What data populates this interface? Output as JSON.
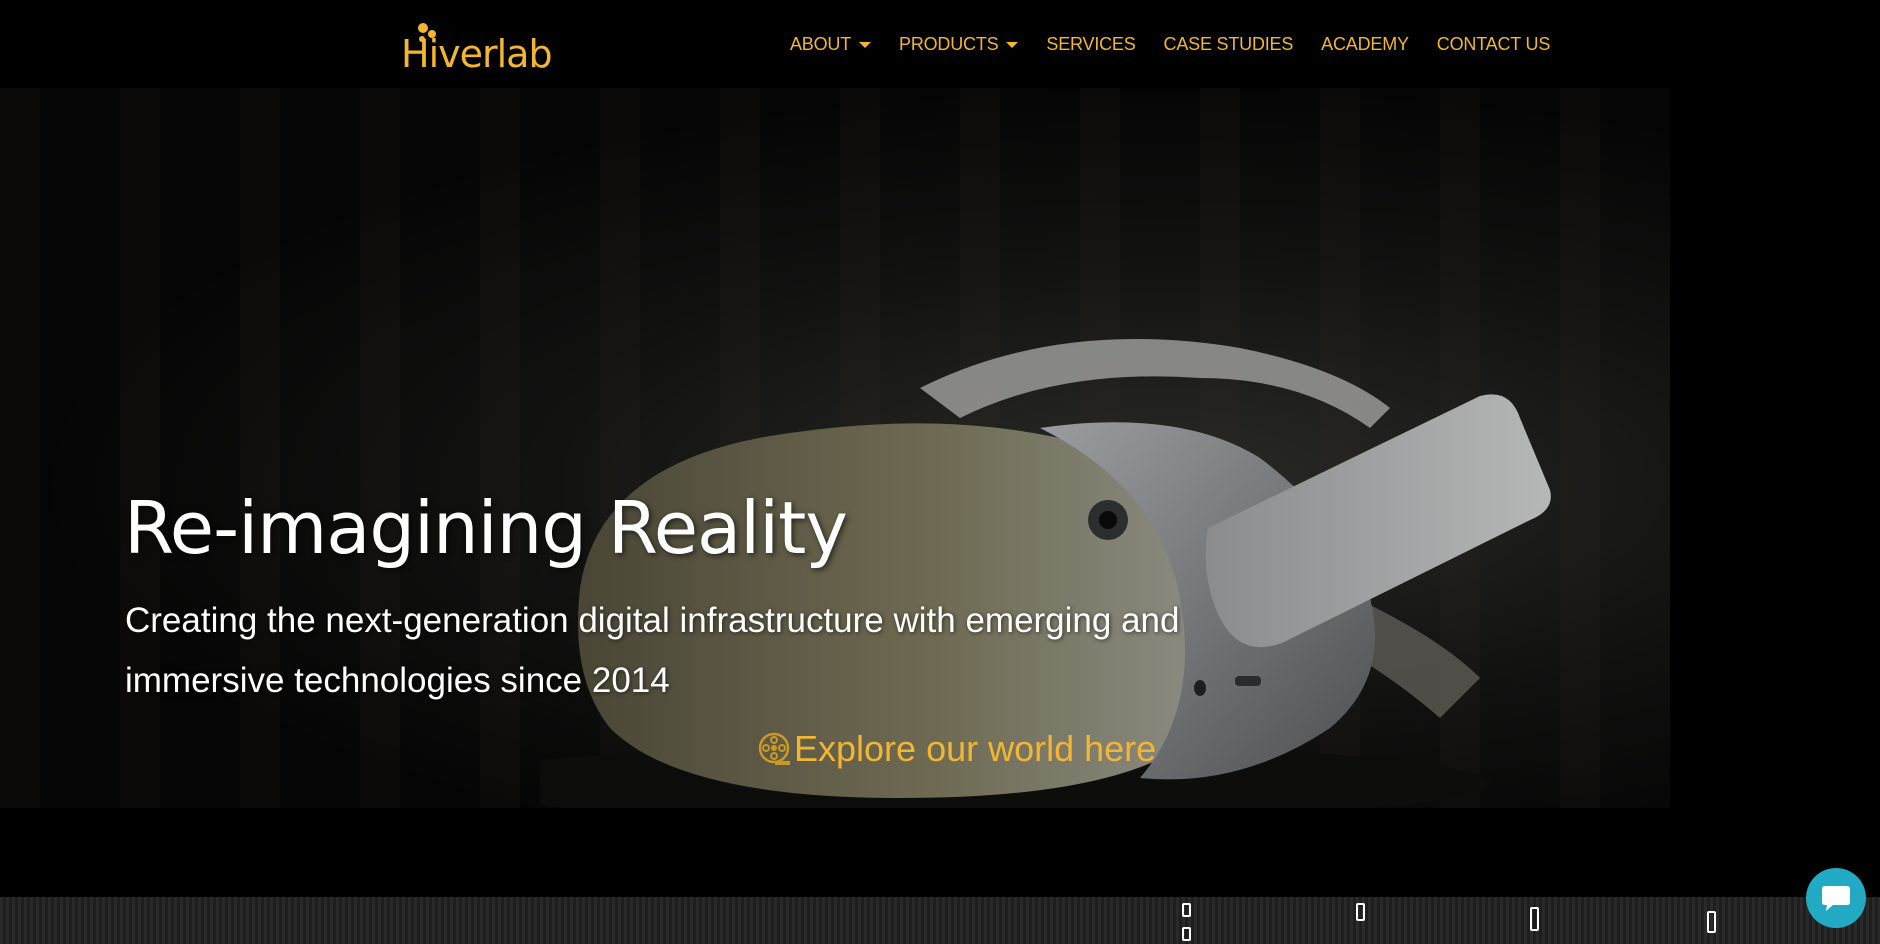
{
  "brand": {
    "logo_text": "Hiverlab",
    "accent_color": "#f2b632"
  },
  "nav": {
    "items": [
      {
        "label": "ABOUT",
        "dropdown": true
      },
      {
        "label": "PRODUCTS",
        "dropdown": true
      },
      {
        "label": "SERVICES",
        "dropdown": false
      },
      {
        "label": "CASE STUDIES",
        "dropdown": false
      },
      {
        "label": "ACADEMY",
        "dropdown": false
      },
      {
        "label": "CONTACT US",
        "dropdown": false
      }
    ]
  },
  "hero": {
    "title": "Re-imagining Reality",
    "subtitle": "Creating the next-generation digital infrastructure with emerging and immersive technologies since 2014",
    "explore_label": "Explore our world here",
    "explore_icon": "film-reel-icon",
    "background_image": "vr-headset-photo"
  },
  "chat": {
    "icon": "chat-bubble-icon",
    "color": "#22a9c4"
  }
}
